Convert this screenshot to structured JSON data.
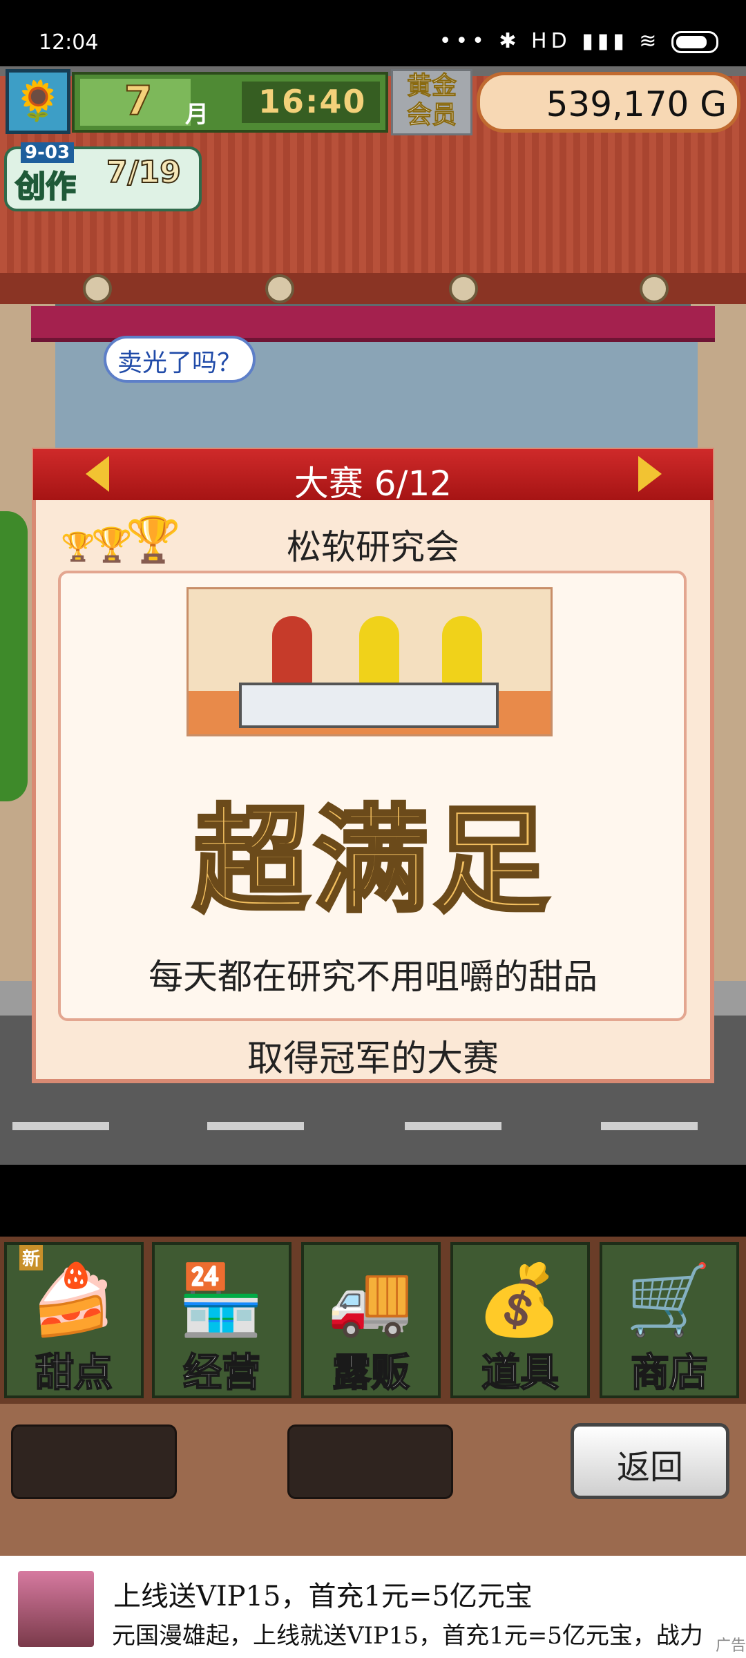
{
  "status_bar": {
    "time": "12:04",
    "icons": "••• ✱ HD ▮▮▮ ≋"
  },
  "hud": {
    "avatar_icon": "sunflower-icon",
    "month_number": "7",
    "month_unit": "月",
    "time": "16:40",
    "vip_label": "黄金会员",
    "money": "539,170 G"
  },
  "create_counter": {
    "label": "创作",
    "date": "9-03",
    "count": "7/19"
  },
  "speech_bubble": "卖光了吗？",
  "dialog": {
    "title": "大赛 6/12",
    "team_name": "松软研究会",
    "rating": "超满足",
    "comment": "每天都在研究不用咀嚼的甜品",
    "footer": "取得冠军的大赛"
  },
  "menu": {
    "new_tag": "新",
    "items": [
      {
        "label": "甜点",
        "icon": "cake-icon",
        "glyph": "🍰"
      },
      {
        "label": "经营",
        "icon": "shop-icon",
        "glyph": "🏪"
      },
      {
        "label": "露贩",
        "icon": "food-truck-icon",
        "glyph": "🚚"
      },
      {
        "label": "道具",
        "icon": "items-bag-icon",
        "glyph": "💰"
      },
      {
        "label": "商店",
        "icon": "shopping-cart-icon",
        "glyph": "🛒"
      }
    ],
    "back_label": "返回"
  },
  "ad": {
    "title": "上线送VIP15，首充1元=5亿元宝",
    "description": "元国漫雄起，上线就送VIP15，首充1元=5亿元宝，战力",
    "mark": "广告"
  }
}
